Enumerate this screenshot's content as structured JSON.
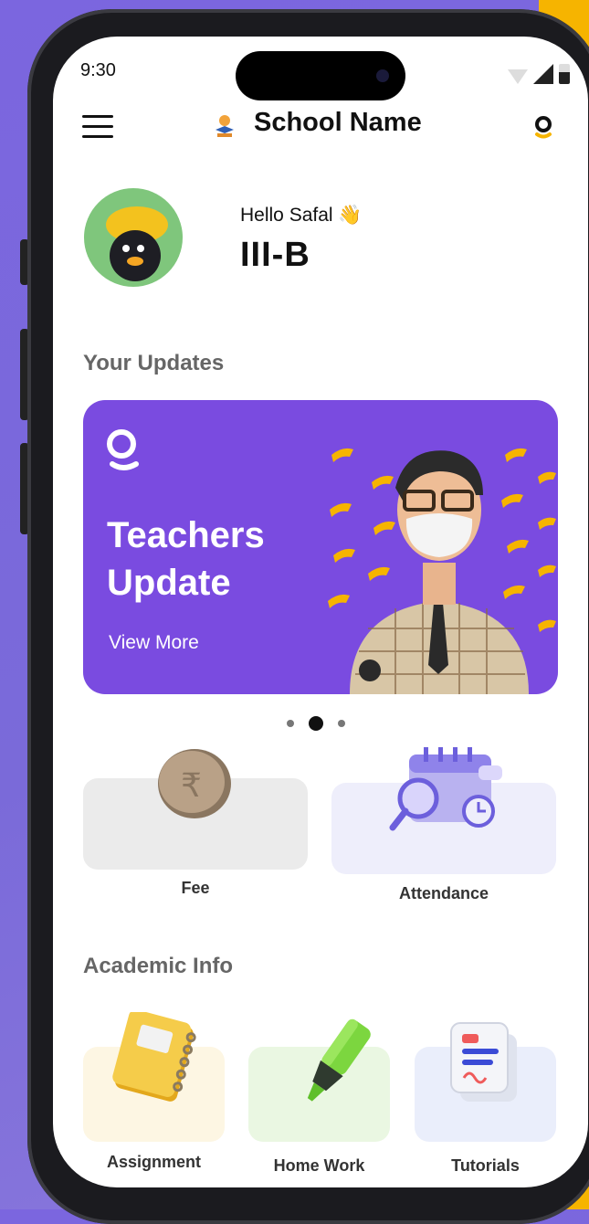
{
  "status_bar": {
    "time": "9:30"
  },
  "header": {
    "app_title": "School Name",
    "menu_icon": "menu-icon",
    "brand_icon": "brand-logo-icon"
  },
  "profile": {
    "greeting": "Hello Safal 👋",
    "class": "III-B"
  },
  "updates": {
    "section_title": "Your Updates",
    "banner": {
      "title_line1": "Teachers",
      "title_line2": "Update",
      "link_label": "View More"
    },
    "carousel": {
      "count": 3,
      "active_index": 1
    }
  },
  "quick_tiles": [
    {
      "label": "Fee",
      "icon": "coin-rupee-icon"
    },
    {
      "label": "Attendance",
      "icon": "calendar-search-icon"
    }
  ],
  "academic": {
    "section_title": "Academic Info",
    "tiles": [
      {
        "label": "Assignment",
        "icon": "notebook-icon"
      },
      {
        "label": "Home Work",
        "icon": "highlighter-icon"
      },
      {
        "label": "Tutorials",
        "icon": "documents-icon"
      }
    ]
  },
  "colors": {
    "banner": "#7a4be0",
    "accent_yellow": "#f6b400",
    "fee_tile": "#ebebeb",
    "attendance_tile": "#eeeefb",
    "assignment_tile": "#fdf6e3",
    "homework_tile": "#eaf7e2",
    "tutorials_tile": "#eaeefb"
  }
}
